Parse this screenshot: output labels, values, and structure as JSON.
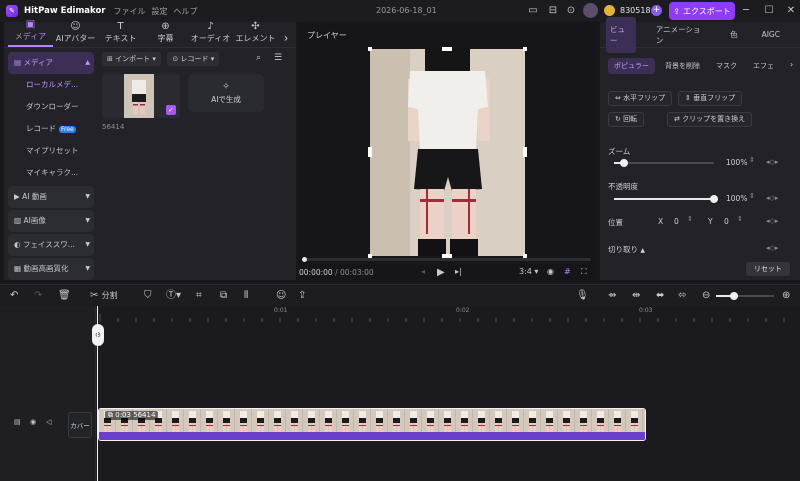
{
  "app": {
    "name": "HitPaw Edimakor",
    "menu": [
      "ファイル",
      "設定",
      "ヘルプ"
    ],
    "project_title": "2026-06-18_01",
    "coins": "830518",
    "export_label": "エクスポート"
  },
  "left_panel": {
    "tabs": [
      {
        "label": "メディア",
        "icon": "media-icon",
        "active": true
      },
      {
        "label": "AIアバター",
        "icon": "avatar-icon"
      },
      {
        "label": "テキスト",
        "icon": "text-icon"
      },
      {
        "label": "字幕",
        "icon": "subtitle-icon"
      },
      {
        "label": "オーディオ",
        "icon": "audio-icon"
      },
      {
        "label": "エレメント",
        "icon": "element-icon"
      }
    ],
    "sidebar": [
      {
        "label": "メディア",
        "active": true,
        "chevron": "up"
      },
      {
        "label": "ローカルメデ...",
        "sub": true,
        "highlight": true
      },
      {
        "label": "ダウンローダー",
        "sub": true
      },
      {
        "label": "レコード",
        "sub": true,
        "badge": "Free"
      },
      {
        "label": "マイプリセット",
        "sub": true
      },
      {
        "label": "マイキャラク...",
        "sub": true
      },
      {
        "label": "AI 動画",
        "group": true
      },
      {
        "label": "AI画像",
        "group": true
      },
      {
        "label": "フェイススワ...",
        "group": true
      },
      {
        "label": "動画高画質化",
        "group": true
      }
    ],
    "import_label": "インポート",
    "record_label": "レコード",
    "media_items": [
      {
        "name": "56414",
        "selected": true
      }
    ],
    "ai_generate_label": "AIで生成"
  },
  "player": {
    "title": "プレイヤー",
    "current_time": "00:00:00",
    "total_time": "00:03:00",
    "aspect_ratio": "3:4",
    "progress": 0
  },
  "right_panel": {
    "tabs": [
      "ビュー",
      "アニメーション",
      "色",
      "AIGC"
    ],
    "active_tab": "ビュー",
    "subtabs": [
      "ポピュラー",
      "背景を削除",
      "マスク",
      "エフェ"
    ],
    "buttons": [
      "水平フリップ",
      "垂直フリップ",
      "回転",
      "クリップを置き換え"
    ],
    "zoom_label": "ズーム",
    "zoom_value": "100%",
    "zoom_level": 0.1,
    "opacity_label": "不透明度",
    "opacity_value": "100%",
    "opacity_level": 1.0,
    "position_label": "位置",
    "pos_x_label": "X",
    "pos_x": "0",
    "pos_y_label": "Y",
    "pos_y": "0",
    "crop_label": "切り取り",
    "reset_label": "リセット"
  },
  "timeline": {
    "split_label": "分割",
    "ruler_ticks": [
      "0:01",
      "0:02",
      "0:03"
    ],
    "clip_label": "0:03 56414",
    "cover_label": "カバー"
  },
  "colors": {
    "accent": "#8e3df5",
    "active_text": "#c89bff",
    "clip_bar": "#6a3fc9"
  }
}
